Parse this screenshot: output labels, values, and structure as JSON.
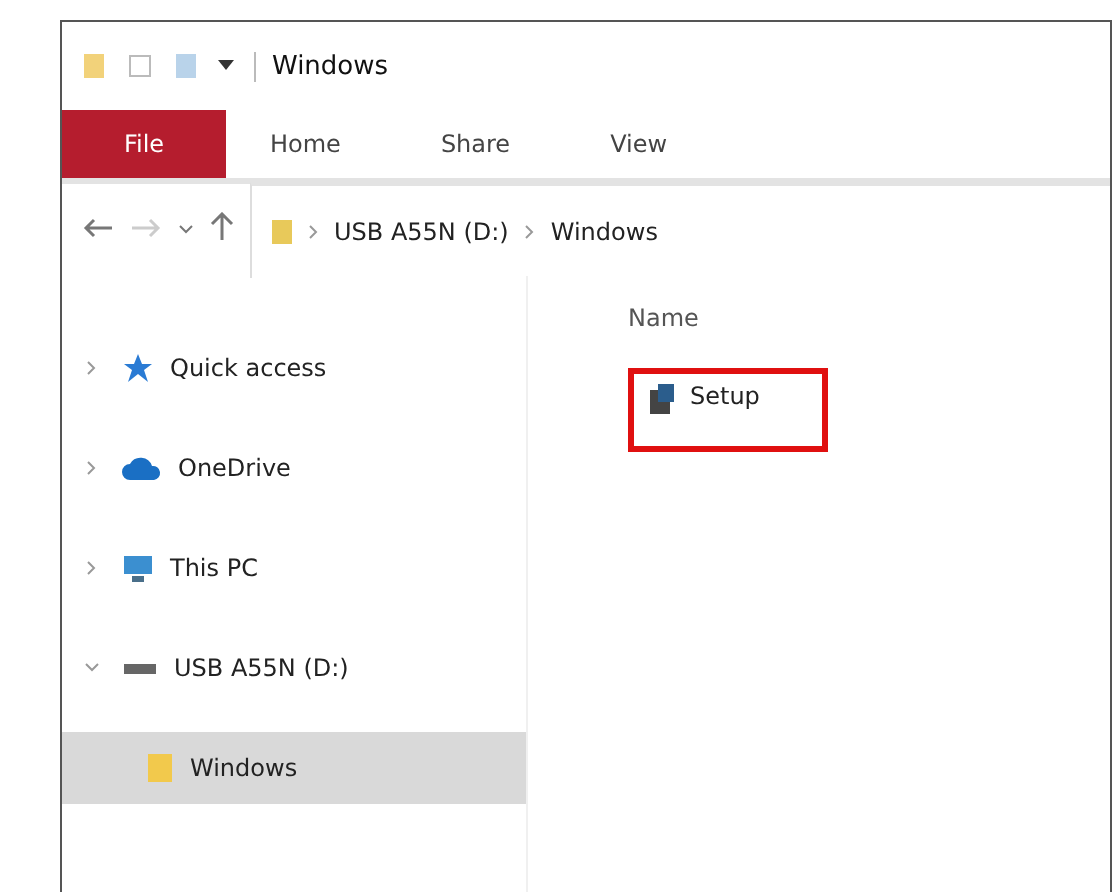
{
  "window": {
    "title": "Windows"
  },
  "ribbon_tabs": [
    {
      "label": "File",
      "kind": "file"
    },
    {
      "label": "Home",
      "kind": "tab"
    },
    {
      "label": "Share",
      "kind": "tab"
    },
    {
      "label": "View",
      "kind": "tab"
    }
  ],
  "address_bar": {
    "path": [
      "USB A55N (D:)",
      "Windows"
    ]
  },
  "navigation_pane": {
    "items": [
      {
        "label": "Quick access",
        "kind": "star",
        "expanded": false,
        "selected": false
      },
      {
        "label": "OneDrive",
        "kind": "cloud",
        "expanded": false,
        "selected": false
      },
      {
        "label": "This PC",
        "kind": "pc",
        "expanded": false,
        "selected": false
      },
      {
        "label": "USB A55N (D:)",
        "kind": "drive",
        "expanded": true,
        "selected": false,
        "children": [
          {
            "label": "Windows",
            "kind": "folder",
            "selected": true
          }
        ]
      }
    ]
  },
  "file_list": {
    "column_header": "Name",
    "files": [
      {
        "name": "Setup",
        "highlighted": true
      }
    ]
  }
}
